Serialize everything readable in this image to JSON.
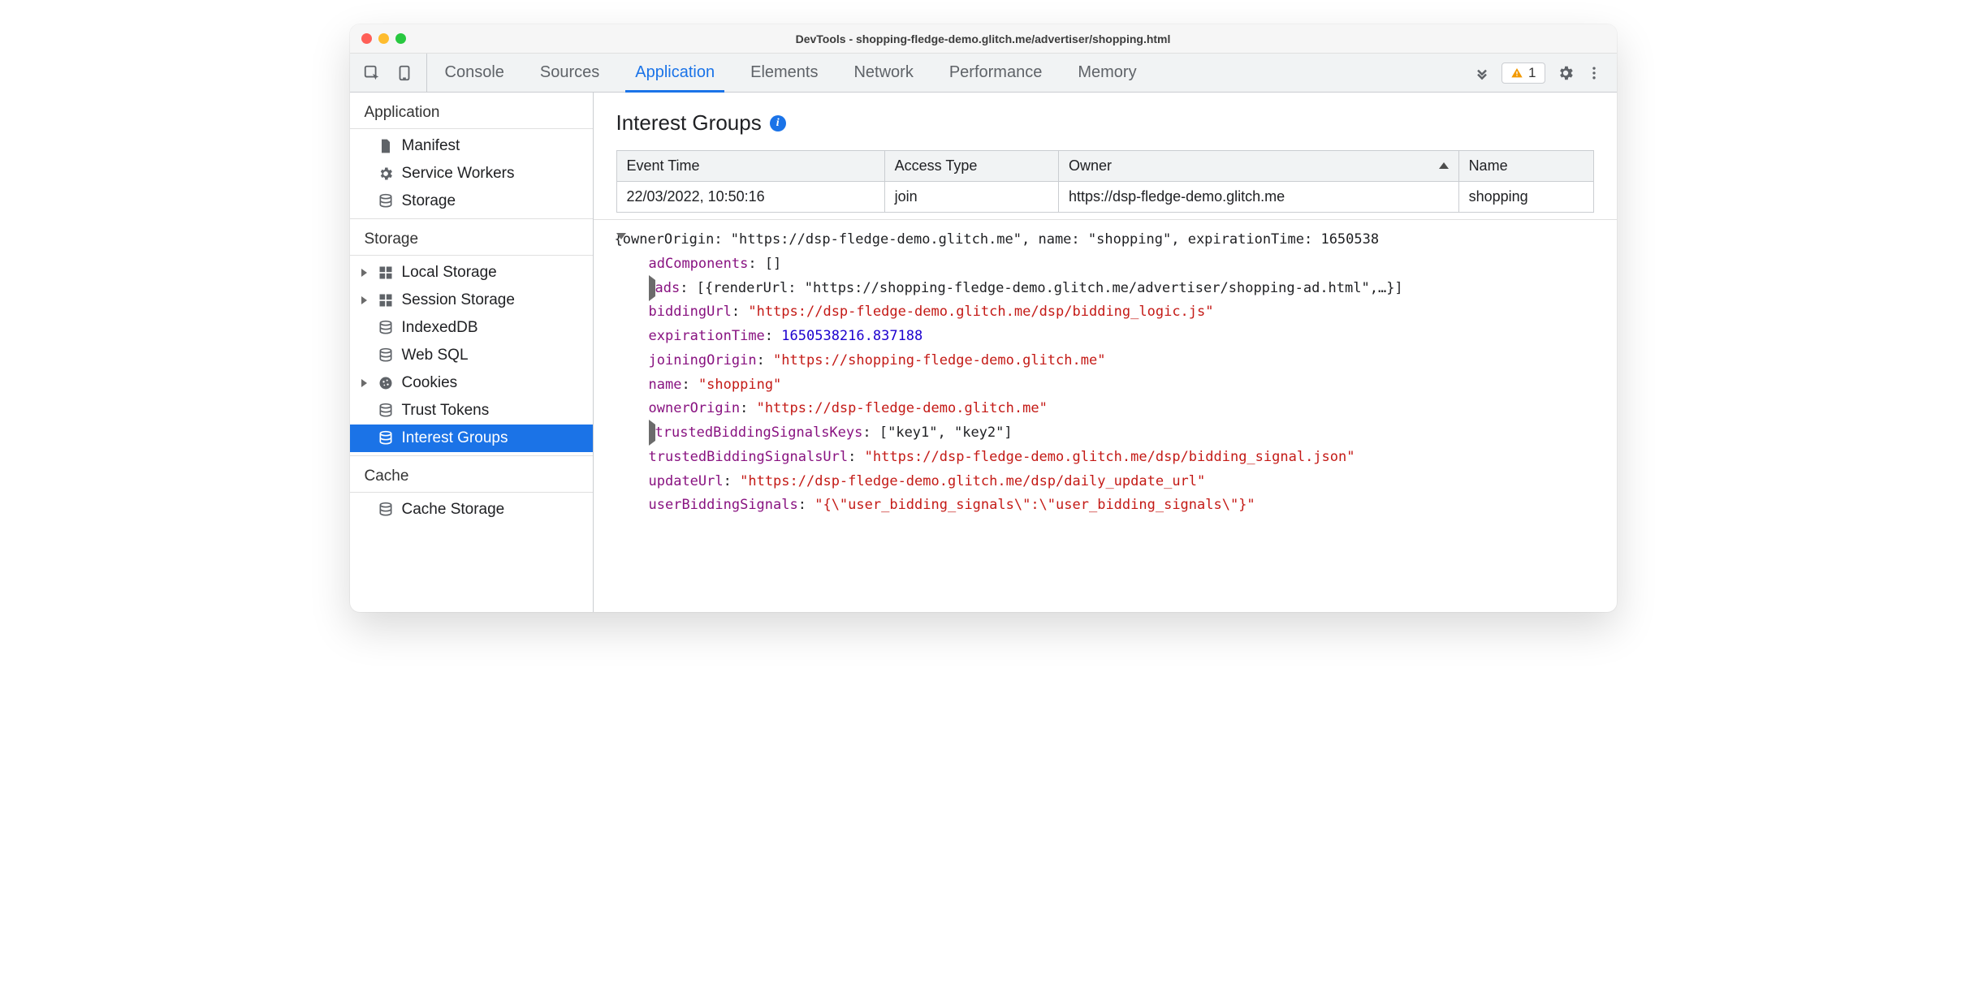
{
  "window_title": "DevTools - shopping-fledge-demo.glitch.me/advertiser/shopping.html",
  "toolbar": {
    "tabs": [
      "Console",
      "Sources",
      "Application",
      "Elements",
      "Network",
      "Performance",
      "Memory"
    ],
    "active_tab": 2,
    "warning_count": "1"
  },
  "sidebar": {
    "sections": [
      {
        "title": "Application",
        "items": [
          {
            "icon": "file",
            "label": "Manifest",
            "chev": false
          },
          {
            "icon": "gear",
            "label": "Service Workers",
            "chev": false
          },
          {
            "icon": "db",
            "label": "Storage",
            "chev": false
          }
        ]
      },
      {
        "title": "Storage",
        "items": [
          {
            "icon": "grid",
            "label": "Local Storage",
            "chev": true
          },
          {
            "icon": "grid",
            "label": "Session Storage",
            "chev": true
          },
          {
            "icon": "db",
            "label": "IndexedDB",
            "chev": false
          },
          {
            "icon": "db",
            "label": "Web SQL",
            "chev": false
          },
          {
            "icon": "cookie",
            "label": "Cookies",
            "chev": true
          },
          {
            "icon": "db",
            "label": "Trust Tokens",
            "chev": false
          },
          {
            "icon": "db",
            "label": "Interest Groups",
            "chev": false,
            "selected": true
          }
        ]
      },
      {
        "title": "Cache",
        "items": [
          {
            "icon": "db",
            "label": "Cache Storage",
            "chev": false
          }
        ]
      }
    ]
  },
  "panel": {
    "title": "Interest Groups",
    "table": {
      "headers": [
        "Event Time",
        "Access Type",
        "Owner",
        "Name"
      ],
      "sort_col": 2,
      "rows": [
        [
          "22/03/2022, 10:50:16",
          "join",
          "https://dsp-fledge-demo.glitch.me",
          "shopping"
        ]
      ]
    },
    "detail": {
      "summary_prefix": "{ownerOrigin: \"https://dsp-fledge-demo.glitch.me\", name: \"shopping\", expirationTime: 1650538",
      "props": [
        {
          "k": "adComponents",
          "type": "plain",
          "v": "[]"
        },
        {
          "k": "ads",
          "type": "plain",
          "v": "[{renderUrl: \"https://shopping-fledge-demo.glitch.me/advertiser/shopping-ad.html\",…}]",
          "expandable": true
        },
        {
          "k": "biddingUrl",
          "type": "str",
          "v": "\"https://dsp-fledge-demo.glitch.me/dsp/bidding_logic.js\""
        },
        {
          "k": "expirationTime",
          "type": "num",
          "v": "1650538216.837188"
        },
        {
          "k": "joiningOrigin",
          "type": "str",
          "v": "\"https://shopping-fledge-demo.glitch.me\""
        },
        {
          "k": "name",
          "type": "str",
          "v": "\"shopping\""
        },
        {
          "k": "ownerOrigin",
          "type": "str",
          "v": "\"https://dsp-fledge-demo.glitch.me\""
        },
        {
          "k": "trustedBiddingSignalsKeys",
          "type": "plain",
          "v": "[\"key1\", \"key2\"]",
          "expandable": true
        },
        {
          "k": "trustedBiddingSignalsUrl",
          "type": "str",
          "v": "\"https://dsp-fledge-demo.glitch.me/dsp/bidding_signal.json\""
        },
        {
          "k": "updateUrl",
          "type": "str",
          "v": "\"https://dsp-fledge-demo.glitch.me/dsp/daily_update_url\""
        },
        {
          "k": "userBiddingSignals",
          "type": "str",
          "v": "\"{\\\"user_bidding_signals\\\":\\\"user_bidding_signals\\\"}\""
        }
      ]
    }
  }
}
